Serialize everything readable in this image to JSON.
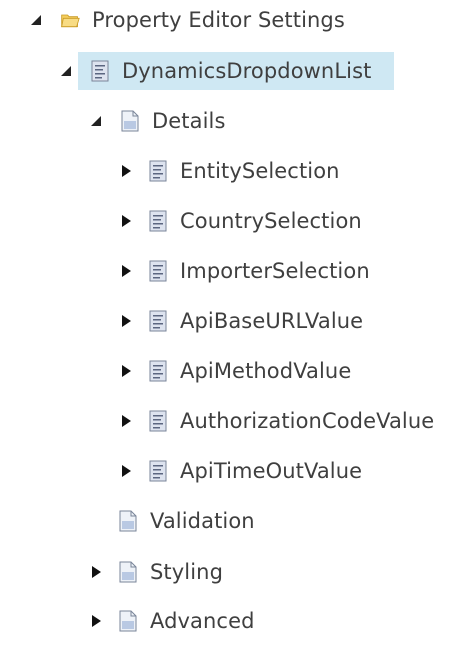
{
  "tree": {
    "root": {
      "label": "Property Editor Settings",
      "expanded": true,
      "icon": "folder-icon"
    },
    "dynamics": {
      "label": "DynamicsDropdownList",
      "expanded": true,
      "selected": true,
      "icon": "property-list-icon"
    },
    "details": {
      "label": "Details",
      "expanded": true,
      "icon": "document-icon"
    },
    "items": [
      {
        "label": "EntitySelection",
        "expanded": false,
        "icon": "property-list-icon"
      },
      {
        "label": "CountrySelection",
        "expanded": false,
        "icon": "property-list-icon"
      },
      {
        "label": "ImporterSelection",
        "expanded": false,
        "icon": "property-list-icon"
      },
      {
        "label": "ApiBaseURLValue",
        "expanded": false,
        "icon": "property-list-icon"
      },
      {
        "label": "ApiMethodValue",
        "expanded": false,
        "icon": "property-list-icon"
      },
      {
        "label": "AuthorizationCodeValue",
        "expanded": false,
        "icon": "property-list-icon"
      },
      {
        "label": "ApiTimeOutValue",
        "expanded": false,
        "icon": "property-list-icon"
      }
    ],
    "validation": {
      "label": "Validation",
      "icon": "document-icon"
    },
    "styling": {
      "label": "Styling",
      "expanded": false,
      "icon": "document-icon"
    },
    "advanced": {
      "label": "Advanced",
      "expanded": false,
      "icon": "document-icon"
    }
  },
  "colors": {
    "selection": "#cfe8f3",
    "text": "#3f3f3f",
    "folder": "#f2c94c"
  }
}
